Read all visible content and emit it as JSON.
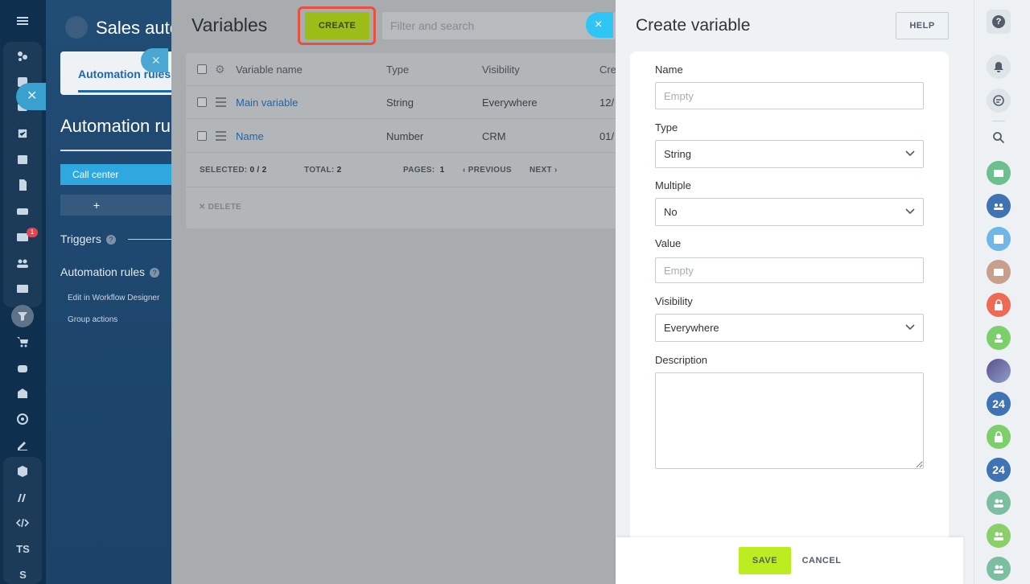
{
  "left_rail": {
    "badge_count": "1",
    "text_items": [
      "TS",
      "S"
    ]
  },
  "background_page": {
    "title": "Sales auto",
    "tab_label": "Automation rules",
    "heading": "Automation ru",
    "stage_button": "Call center",
    "add_label": "+",
    "triggers_label": "Triggers",
    "automation_rules_label": "Automation rules",
    "links": [
      "Edit in Workflow Designer",
      "Group actions"
    ]
  },
  "variables_panel": {
    "title": "Variables",
    "create_label": "CREATE",
    "search_placeholder": "Filter and search",
    "close_icon": "×",
    "columns": [
      "Variable name",
      "Type",
      "Visibility",
      "Cre"
    ],
    "rows": [
      {
        "name": "Main variable",
        "type": "String",
        "visibility": "Everywhere",
        "created": "12/"
      },
      {
        "name": "Name",
        "type": "Number",
        "visibility": "CRM",
        "created": "01/"
      }
    ],
    "footer": {
      "selected_label": "SELECTED:",
      "selected_value": "0 / 2",
      "total_label": "TOTAL:",
      "total_value": "2",
      "pages_label": "PAGES:",
      "pages_value": "1",
      "previous_label": "PREVIOUS",
      "next_label": "NEXT"
    },
    "delete_label": "DELETE"
  },
  "create_variable": {
    "title": "Create variable",
    "help_label": "HELP",
    "fields": {
      "name_label": "Name",
      "name_placeholder": "Empty",
      "type_label": "Type",
      "type_value": "String",
      "multiple_label": "Multiple",
      "multiple_value": "No",
      "value_label": "Value",
      "value_placeholder": "Empty",
      "visibility_label": "Visibility",
      "visibility_value": "Everywhere",
      "description_label": "Description"
    },
    "save_label": "SAVE",
    "cancel_label": "CANCEL"
  },
  "right_sidebar": {
    "help_icon": "?",
    "badge_text_a": "24",
    "badge_text_b": "24"
  },
  "colors": {
    "create_button": "#9cbd17",
    "highlight_outline": "#e8503f",
    "close_button": "#2fc6f6",
    "save_button": "#bbed21",
    "link_blue": "#2066a8"
  }
}
